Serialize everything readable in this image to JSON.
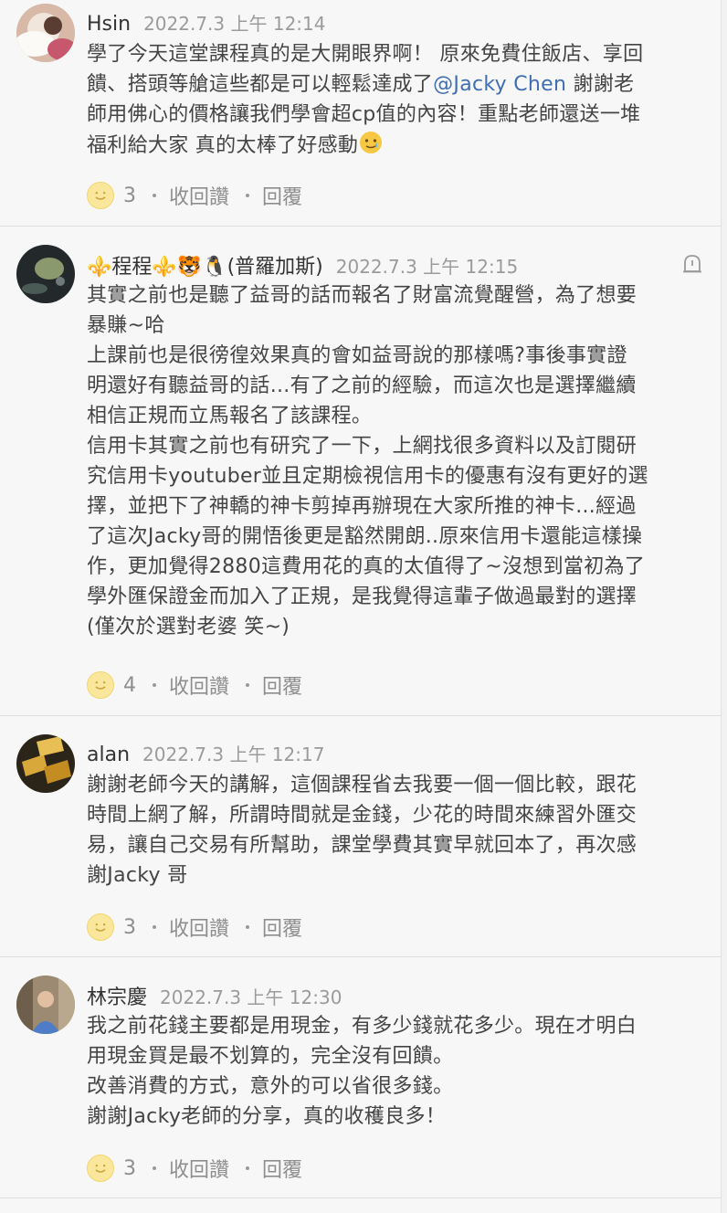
{
  "comments": [
    {
      "author": "Hsin",
      "timestamp": "2022.7.3 上午 12:14",
      "lines": [
        "學了今天這堂課程真的是大開眼界啊！ 原來免費住飯店、享回",
        "饋、搭頭等艙這些都是可以輕鬆達成了",
        "師用佛心的價格讓我們學會超cp值的內容！重點老師還送一堆",
        "福利給大家  真的太棒了好感動"
      ],
      "mention": "@Jacky Chen",
      "mention_after": " 謝謝老",
      "likes": "3",
      "like_label": "收回讚",
      "reply_label": "回覆"
    },
    {
      "author": "⚜️程程⚜️🐯🐧(普羅加斯)",
      "timestamp": "2022.7.3 上午 12:15",
      "lines": [
        "其實之前也是聽了益哥的話而報名了財富流覺醒營，為了想要",
        "暴賺~哈",
        "上課前也是很徬徨效果真的會如益哥說的那樣嗎?事後事實證",
        "明還好有聽益哥的話...有了之前的經驗，而這次也是選擇繼續",
        "相信正規而立馬報名了該課程。",
        "信用卡其實之前也有研究了一下，上網找很多資料以及訂閱研",
        "究信用卡youtuber並且定期檢視信用卡的優惠有沒有更好的選",
        "擇，並把下了神轎的神卡剪掉再辦現在大家所推的神卡...經過",
        "了這次Jacky哥的開悟後更是豁然開朗..原來信用卡還能這樣操",
        "作，更加覺得2880這費用花的真的太值得了~沒想到當初為了",
        "學外匯保證金而加入了正規，是我覺得這輩子做過最對的選擇",
        "(僅次於選對老婆 笑~)"
      ],
      "likes": "4",
      "like_label": "收回讚",
      "reply_label": "回覆"
    },
    {
      "author": "alan",
      "timestamp": "2022.7.3 上午 12:17",
      "lines": [
        "謝謝老師今天的講解，這個課程省去我要一個一個比較，跟花",
        "時間上網了解，所謂時間就是金錢，少花的時間來練習外匯交",
        "易，讓自己交易有所幫助，課堂學費其實早就回本了，再次感",
        "謝Jacky 哥"
      ],
      "likes": "3",
      "like_label": "收回讚",
      "reply_label": "回覆"
    },
    {
      "author": "林宗慶",
      "timestamp": "2022.7.3 上午 12:30",
      "lines": [
        "我之前花錢主要都是用現金，有多少錢就花多少。現在才明白",
        "用現金買是最不划算的，完全沒有回饋。",
        "改善消費的方式，意外的可以省很多錢。",
        "謝謝Jacky老師的分享，真的收穫良多！"
      ],
      "likes": "3",
      "like_label": "收回讚",
      "reply_label": "回覆"
    }
  ],
  "icons": {
    "like": "smile-icon",
    "report": "report-icon",
    "emoji": "tear-smile-emoji"
  },
  "colors": {
    "mention": "#3f6eb3",
    "timestamp": "#9b9b9b",
    "like_face": "#fbe79b"
  }
}
